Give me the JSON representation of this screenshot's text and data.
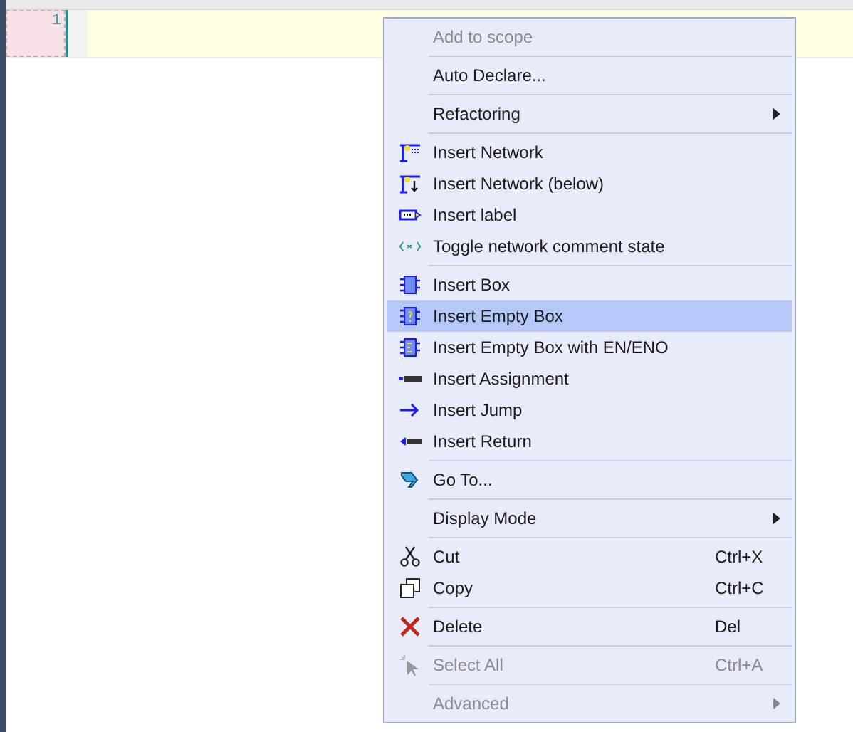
{
  "editor": {
    "line_numbers": [
      "1"
    ]
  },
  "context_menu": {
    "items": [
      {
        "kind": "item",
        "label": "Add to scope",
        "disabled": true,
        "selected": false,
        "submenu": false
      },
      {
        "kind": "separator"
      },
      {
        "kind": "item",
        "label": "Auto Declare...",
        "disabled": false,
        "selected": false,
        "submenu": false
      },
      {
        "kind": "separator"
      },
      {
        "kind": "item",
        "label": "Refactoring",
        "disabled": false,
        "selected": false,
        "submenu": true
      },
      {
        "kind": "separator"
      },
      {
        "kind": "item",
        "label": "Insert Network",
        "disabled": false,
        "selected": false,
        "submenu": false
      },
      {
        "kind": "item",
        "label": "Insert Network (below)",
        "disabled": false,
        "selected": false,
        "submenu": false
      },
      {
        "kind": "item",
        "label": "Insert label",
        "disabled": false,
        "selected": false,
        "submenu": false
      },
      {
        "kind": "item",
        "label": "Toggle network comment state",
        "disabled": false,
        "selected": false,
        "submenu": false
      },
      {
        "kind": "separator"
      },
      {
        "kind": "item",
        "label": "Insert Box",
        "disabled": false,
        "selected": false,
        "submenu": false
      },
      {
        "kind": "item",
        "label": "Insert Empty Box",
        "disabled": false,
        "selected": true,
        "submenu": false
      },
      {
        "kind": "item",
        "label": "Insert Empty Box with EN/ENO",
        "disabled": false,
        "selected": false,
        "submenu": false
      },
      {
        "kind": "item",
        "label": "Insert Assignment",
        "disabled": false,
        "selected": false,
        "submenu": false
      },
      {
        "kind": "item",
        "label": "Insert Jump",
        "disabled": false,
        "selected": false,
        "submenu": false
      },
      {
        "kind": "item",
        "label": "Insert Return",
        "disabled": false,
        "selected": false,
        "submenu": false
      },
      {
        "kind": "separator"
      },
      {
        "kind": "item",
        "label": "Go To...",
        "disabled": false,
        "selected": false,
        "submenu": false
      },
      {
        "kind": "separator"
      },
      {
        "kind": "item",
        "label": "Display Mode",
        "disabled": false,
        "selected": false,
        "submenu": true
      },
      {
        "kind": "separator"
      },
      {
        "kind": "item",
        "label": "Cut",
        "shortcut": "Ctrl+X",
        "disabled": false,
        "selected": false,
        "submenu": false
      },
      {
        "kind": "item",
        "label": "Copy",
        "shortcut": "Ctrl+C",
        "disabled": false,
        "selected": false,
        "submenu": false
      },
      {
        "kind": "separator"
      },
      {
        "kind": "item",
        "label": "Delete",
        "shortcut": "Del",
        "disabled": false,
        "selected": false,
        "submenu": false
      },
      {
        "kind": "separator"
      },
      {
        "kind": "item",
        "label": "Select All",
        "shortcut": "Ctrl+A",
        "disabled": true,
        "selected": false,
        "submenu": false
      },
      {
        "kind": "separator"
      },
      {
        "kind": "item",
        "label": "Advanced",
        "disabled": true,
        "selected": false,
        "submenu": true
      }
    ]
  }
}
